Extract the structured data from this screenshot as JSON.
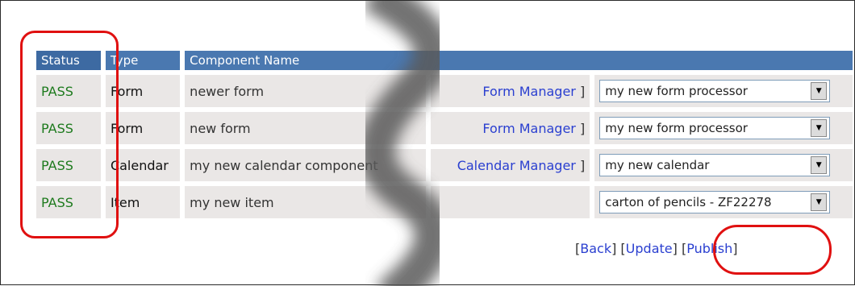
{
  "table": {
    "headers": [
      "Status",
      "Type",
      "Component Name"
    ],
    "rows": [
      {
        "status": "PASS",
        "type": "Form",
        "name": "newer form",
        "manager": "Form Manager",
        "select_value": "my new form processor"
      },
      {
        "status": "PASS",
        "type": "Form",
        "name": "new form",
        "manager": "Form Manager",
        "select_value": "my new form processor"
      },
      {
        "status": "PASS",
        "type": "Calendar",
        "name": "my new calendar component",
        "manager": "Calendar Manager",
        "select_value": "my new calendar"
      },
      {
        "status": "PASS",
        "type": "Item",
        "name": "my new item",
        "manager": "",
        "select_value": "carton of pencils - ZF22278"
      }
    ]
  },
  "actions": {
    "back": "Back",
    "update": "Update",
    "publish": "Publish"
  },
  "colors": {
    "header_bg": "#4a78b0",
    "pass_text": "#1d7a1d",
    "highlight": "#e01010",
    "link": "#2a3fd0"
  }
}
